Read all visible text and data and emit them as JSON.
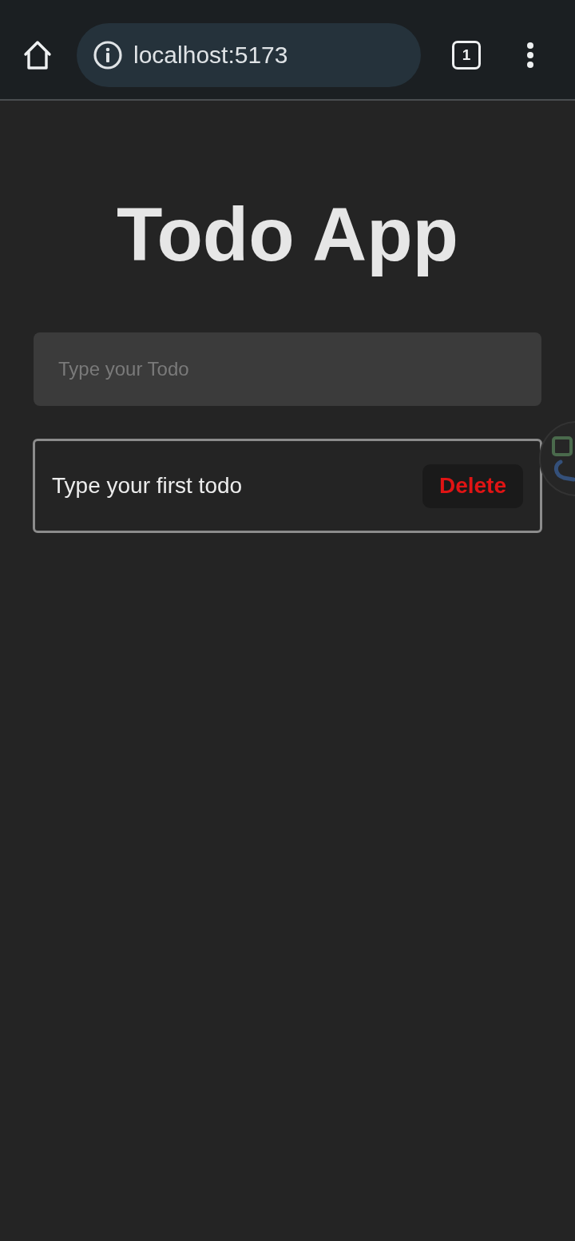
{
  "browser": {
    "url": "localhost:5173",
    "tab_count": "1"
  },
  "title": "Todo App",
  "new_todo": {
    "placeholder": "Type your Todo"
  },
  "todos": [
    {
      "text": "Type your first todo",
      "action": "Delete"
    }
  ]
}
